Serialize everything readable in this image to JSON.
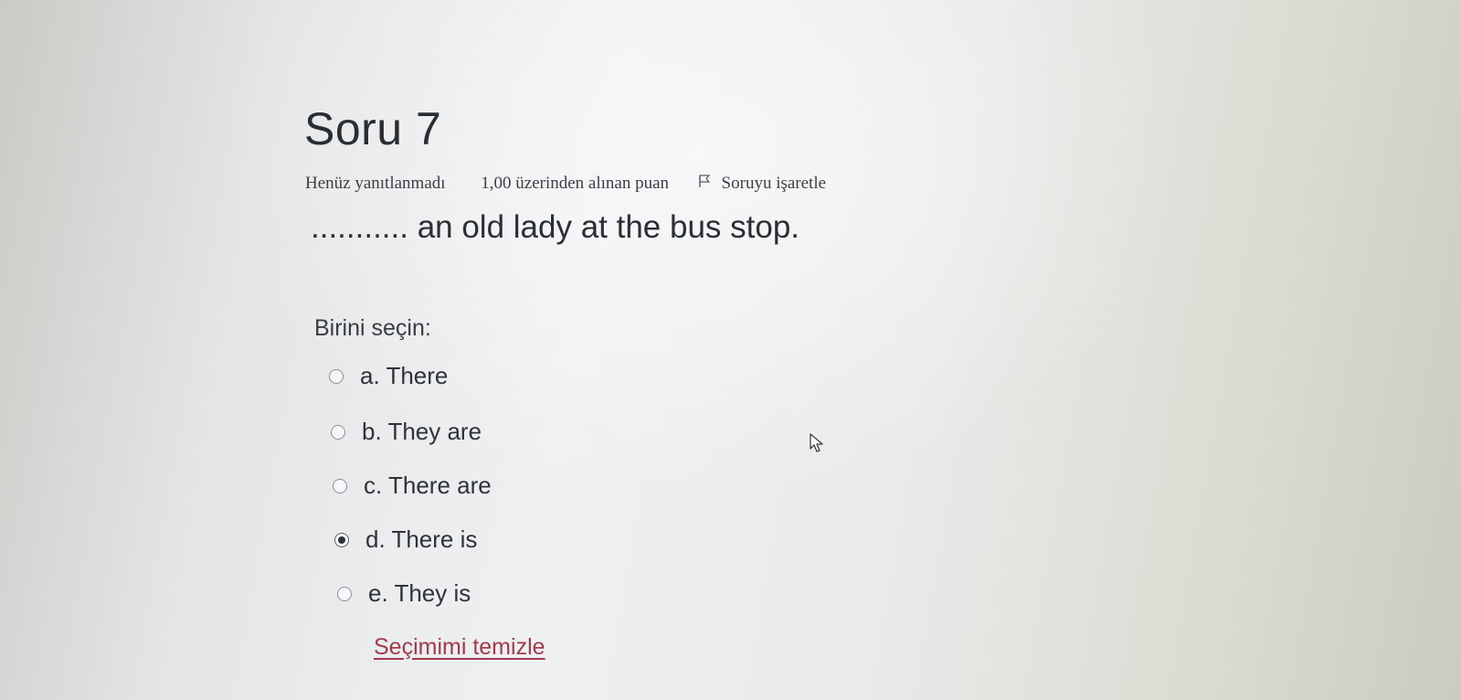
{
  "question": {
    "title": "Soru 7",
    "status": "Henüz yanıtlanmadı",
    "grade": "1,00 üzerinden alınan puan",
    "flag_label": "Soruyu işaretle",
    "text": "........... an old lady at the bus stop.",
    "prompt": "Birini seçin:"
  },
  "options": [
    {
      "label": "a. There",
      "selected": false
    },
    {
      "label": "b. They are",
      "selected": false
    },
    {
      "label": "c. There are",
      "selected": false
    },
    {
      "label": "d. There is",
      "selected": true
    },
    {
      "label": "e. They is",
      "selected": false
    }
  ],
  "clear_choice": "Seçimimi temizle",
  "colors": {
    "link": "#a33a4c",
    "text": "#2c2e33"
  },
  "icons": {
    "flag": "flag-icon",
    "radio": "radio-icon",
    "cursor": "mouse-pointer-icon"
  }
}
